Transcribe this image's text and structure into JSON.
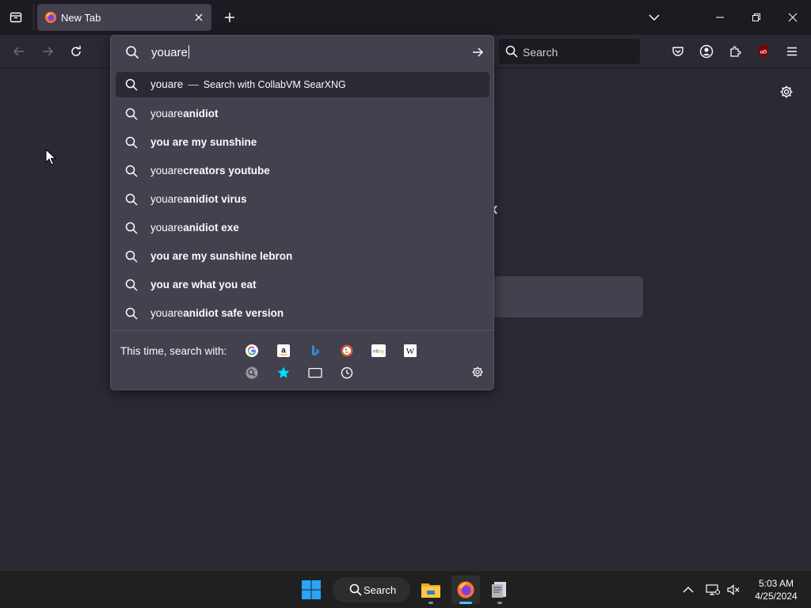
{
  "window": {
    "tab_title": "New Tab"
  },
  "toolbar": {
    "search_placeholder": "Search"
  },
  "urlbar": {
    "typed_text": "youare"
  },
  "results": [
    {
      "prefix": "youare",
      "bold": "",
      "action_dash": "—",
      "action": "Search with CollabVM SearXNG",
      "selected": true
    },
    {
      "prefix": "youare",
      "bold": "anidiot"
    },
    {
      "prefix": "",
      "bold": "you are my sunshine"
    },
    {
      "prefix": "youare",
      "bold": "creators youtube"
    },
    {
      "prefix": "youare",
      "bold": "anidiot virus"
    },
    {
      "prefix": "youare",
      "bold": "anidiot exe"
    },
    {
      "prefix": "",
      "bold": "you are my sunshine lebron"
    },
    {
      "prefix": "",
      "bold": "you are what you eat"
    },
    {
      "prefix": "youare",
      "bold": "anidiot safe version"
    }
  ],
  "oneoffs": {
    "label": "This time, search with:",
    "engines": [
      "google-icon",
      "amazon-icon",
      "bing-icon",
      "duckduckgo-icon",
      "ebay-icon",
      "wikipedia-icon",
      "searxng-icon",
      "bookmarks-icon",
      "tabs-icon",
      "history-icon"
    ]
  },
  "taskbar": {
    "search_label": "Search",
    "time": "5:03 AM",
    "date": "4/25/2024"
  },
  "colors": {
    "chrome_bg": "#1c1b22",
    "toolbar_bg": "#2b2a33",
    "popup_bg": "#42414d",
    "taskbar_bg": "#202020",
    "accent": "#0078d4"
  }
}
